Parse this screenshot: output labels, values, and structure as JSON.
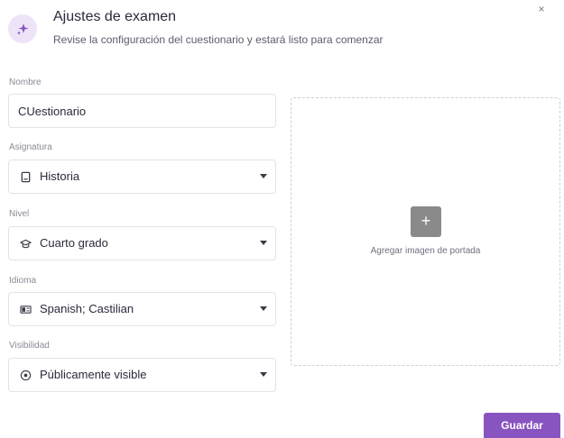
{
  "header": {
    "title": "Ajustes de examen",
    "subtitle": "Revise la configuración del cuestionario y estará listo para comenzar",
    "icon": "sparkle-icon"
  },
  "close_label": "×",
  "form": {
    "name": {
      "label": "Nombre",
      "value": "CUestionario"
    },
    "subject": {
      "label": "Asignatura",
      "value": "Historia",
      "icon": "book-icon"
    },
    "grade": {
      "label": "Nivel",
      "value": "Cuarto grado",
      "icon": "graduation-cap-icon"
    },
    "language": {
      "label": "Idioma",
      "value": "Spanish; Castilian",
      "icon": "language-card-icon"
    },
    "visibility": {
      "label": "Visibilidad",
      "value": "Públicamente visible",
      "icon": "eye-icon"
    }
  },
  "cover": {
    "plus_label": "+",
    "text": "Agregar imagen de portada"
  },
  "actions": {
    "save_label": "Guardar"
  },
  "colors": {
    "accent": "#8854c0",
    "icon_bg": "#ede4f7",
    "border": "#e3e3e8"
  }
}
